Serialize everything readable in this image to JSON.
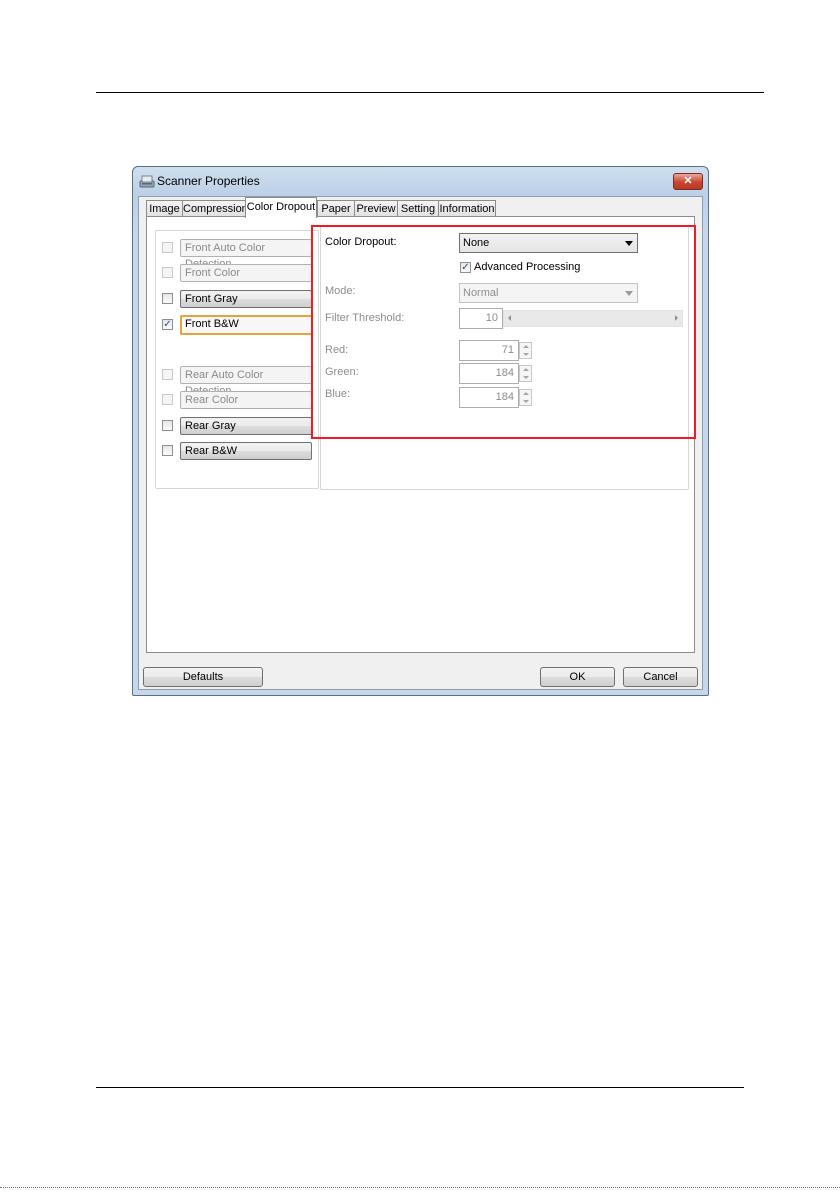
{
  "window": {
    "title": "Scanner Properties",
    "close_glyph": "✕",
    "icon": "scanner-icon"
  },
  "tabs": [
    {
      "label": "Image"
    },
    {
      "label": "Compression"
    },
    {
      "label": "Color Dropout",
      "active": true
    },
    {
      "label": "Paper"
    },
    {
      "label": "Preview"
    },
    {
      "label": "Setting"
    },
    {
      "label": "Information"
    }
  ],
  "image_list": {
    "items": [
      {
        "label": "Front Auto Color Detection",
        "checked": false,
        "enabled": false
      },
      {
        "label": "Front Color",
        "checked": false,
        "enabled": false
      },
      {
        "label": "Front Gray",
        "checked": false,
        "enabled": true
      },
      {
        "label": "Front B&W",
        "checked": true,
        "enabled": true,
        "focused": true
      },
      {
        "label": "Rear Auto Color Detection",
        "checked": false,
        "enabled": false
      },
      {
        "label": "Rear Color",
        "checked": false,
        "enabled": false
      },
      {
        "label": "Rear Gray",
        "checked": false,
        "enabled": true
      },
      {
        "label": "Rear B&W",
        "checked": false,
        "enabled": true
      }
    ],
    "check_glyph": "✓"
  },
  "color_dropout": {
    "label": "Color Dropout:",
    "value": "None",
    "advanced_label": "Advanced Processing",
    "advanced_checked": true,
    "mode_label": "Mode:",
    "mode_value": "Normal",
    "filter_label": "Filter Threshold:",
    "filter_value": "10",
    "red_label": "Red:",
    "red_value": "71",
    "green_label": "Green:",
    "green_value": "184",
    "blue_label": "Blue:",
    "blue_value": "184"
  },
  "buttons": {
    "defaults": "Defaults",
    "ok": "OK",
    "cancel": "Cancel"
  },
  "colors": {
    "highlight_box": "#ee1c24",
    "focus_border": "#e7a33b"
  }
}
